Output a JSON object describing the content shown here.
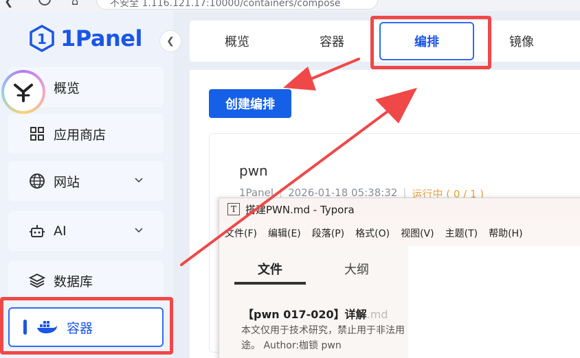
{
  "browser": {
    "address": "不安全   1.116.121.17:10000/containers/compose"
  },
  "sidebar": {
    "logo_text": "1Panel",
    "items": [
      {
        "label": "概览",
        "icon": "home-icon"
      },
      {
        "label": "应用商店",
        "icon": "grid-icon"
      },
      {
        "label": "网站",
        "icon": "globe-icon"
      },
      {
        "label": "AI",
        "icon": "robot-icon"
      },
      {
        "label": "数据库",
        "icon": "layers-icon"
      },
      {
        "label": "容器",
        "icon": "docker-icon"
      }
    ]
  },
  "tabs": [
    {
      "label": "概览"
    },
    {
      "label": "容器"
    },
    {
      "label": "编排"
    },
    {
      "label": "镜像"
    }
  ],
  "main": {
    "create_button": "创建编排",
    "card": {
      "name": "pwn",
      "source": "1Panel",
      "created": "2026-01-18 05:38:32",
      "status": "运行中 ( 0 / 1 )"
    }
  },
  "typora": {
    "title": "搭建PWN.md - Typora",
    "menu": [
      "文件(F)",
      "编辑(E)",
      "段落(P)",
      "格式(O)",
      "视图(V)",
      "主题(T)",
      "帮助(H)"
    ],
    "side_tabs": [
      "文件",
      "大纲"
    ],
    "file_title": "【pwn 017-020】详解",
    "file_ext": ".md",
    "file_desc": "本文仅用于技术研究，禁止用于非法用途。 Author:枷锁 pwn"
  },
  "colors": {
    "brand": "#1a56e6",
    "highlight": "#f04848",
    "status": "#e6a23c"
  }
}
